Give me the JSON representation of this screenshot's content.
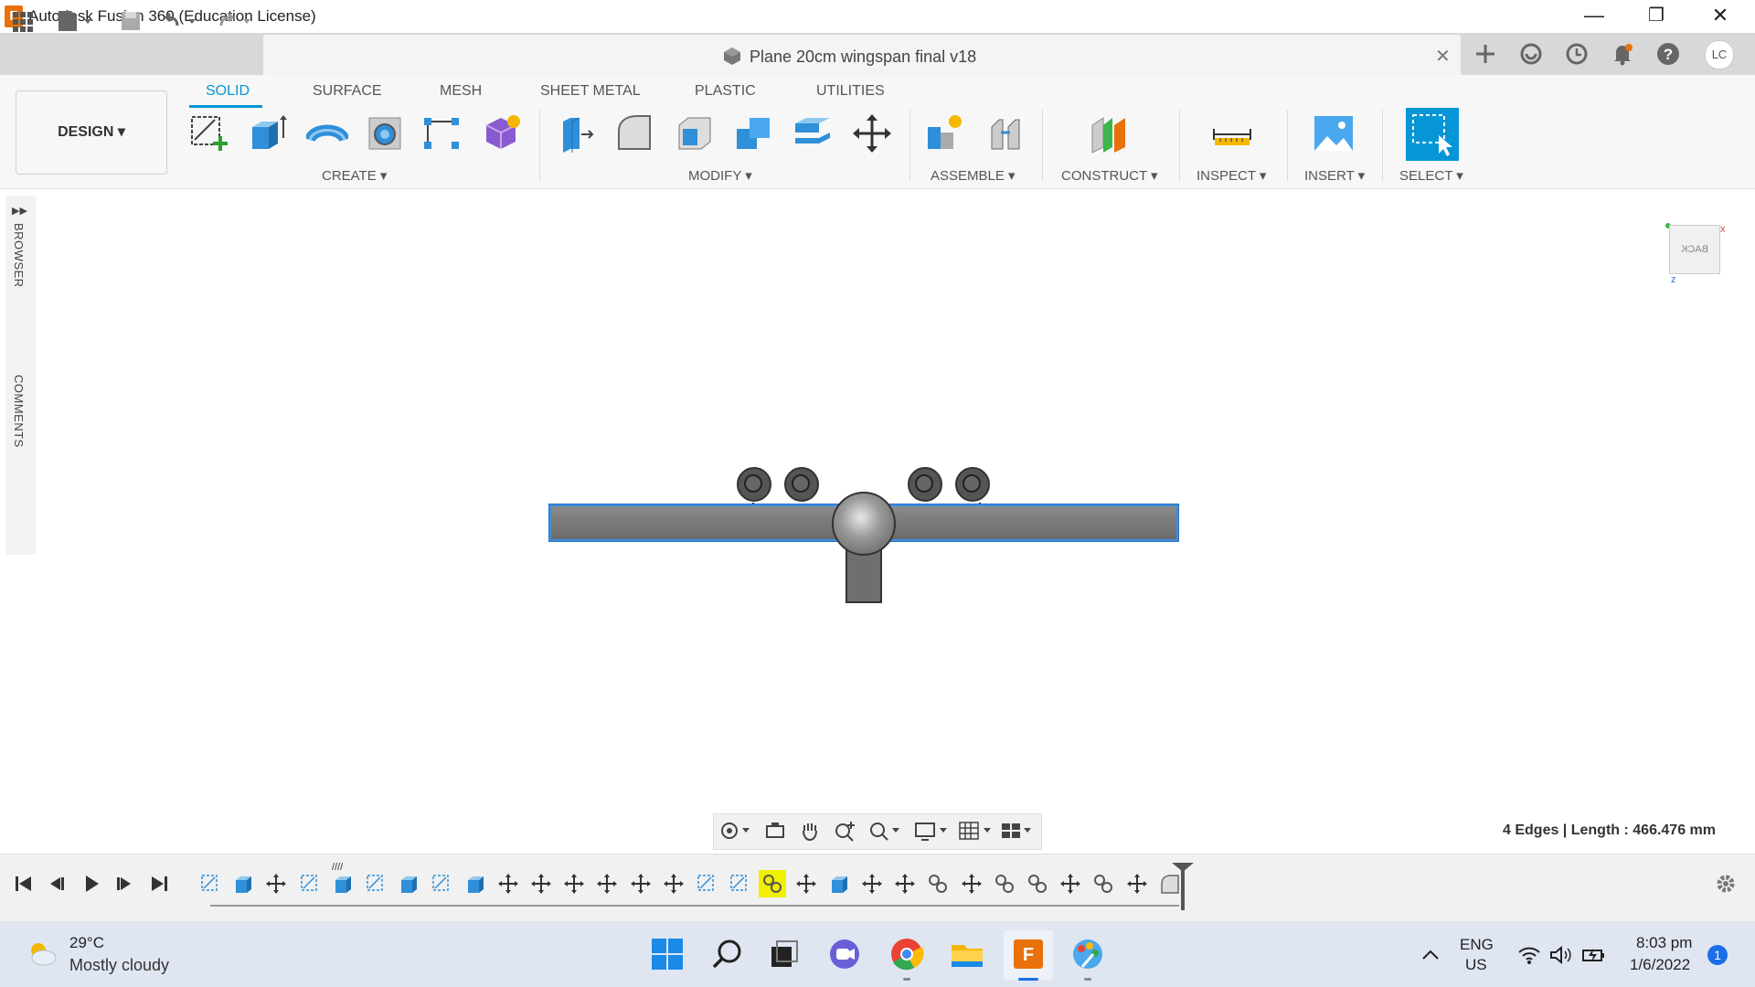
{
  "window": {
    "app_icon_letter": "F",
    "title": "Autodesk Fusion 360 (Education License)",
    "minimize": "—",
    "restore": "❐",
    "close": "✕"
  },
  "document": {
    "title": "Plane 20cm wingspan final v18",
    "close": "✕"
  },
  "user": {
    "initials": "LC"
  },
  "workspace": {
    "label": "DESIGN ▾"
  },
  "ribbon_tabs": [
    "SOLID",
    "SURFACE",
    "MESH",
    "SHEET METAL",
    "PLASTIC",
    "UTILITIES"
  ],
  "active_tab": "SOLID",
  "tool_groups": {
    "create": "CREATE ▾",
    "modify": "MODIFY ▾",
    "assemble": "ASSEMBLE ▾",
    "construct": "CONSTRUCT ▾",
    "inspect": "INSPECT ▾",
    "insert": "INSERT ▾",
    "select": "SELECT ▾"
  },
  "side_panel": {
    "browser": "BROWSER",
    "comments": "COMMENTS"
  },
  "viewcube": {
    "face_label": "BACK"
  },
  "status": {
    "selection": "4 Edges | Length : 466.476 mm"
  },
  "weather": {
    "temp": "29°C",
    "desc": "Mostly cloudy"
  },
  "tray": {
    "lang_top": "ENG",
    "lang_bottom": "US",
    "time": "8:03 pm",
    "date": "1/6/2022",
    "notifications": "1"
  },
  "colors": {
    "accent": "#0696d7",
    "fusion_orange": "#e8710a",
    "selection_blue": "#3c8fdc"
  }
}
